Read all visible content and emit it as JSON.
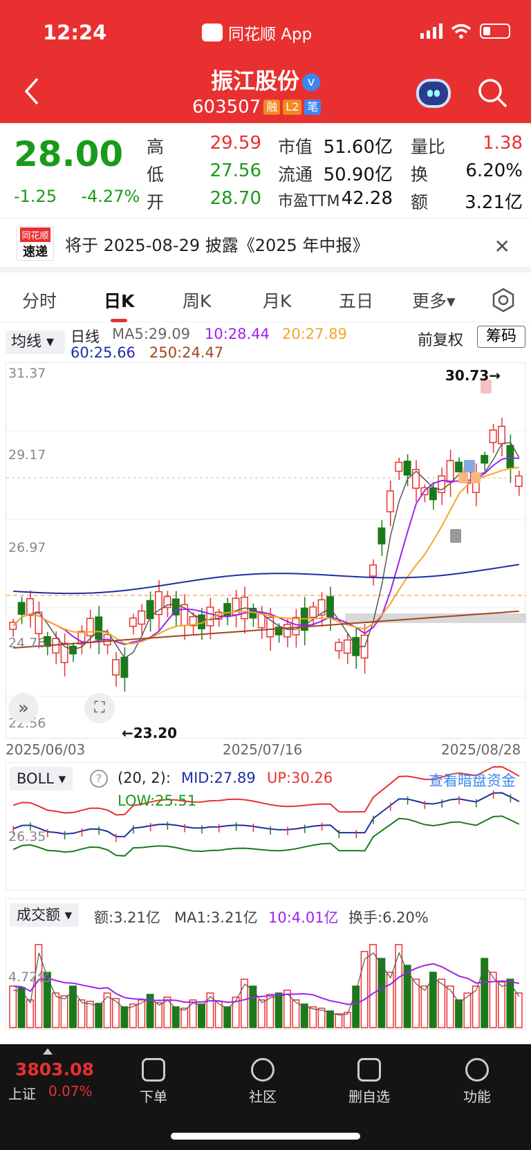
{
  "status_bar": {
    "time": "12:24",
    "app_name": "同花顺 App"
  },
  "header": {
    "stock_name": "振江股份",
    "verified": "v",
    "stock_code": "603507",
    "tags": [
      {
        "text": "融",
        "color": "#f08a24"
      },
      {
        "text": "L2",
        "color": "#f08a24"
      },
      {
        "text": "笔",
        "color": "#3d86f0"
      }
    ]
  },
  "quote": {
    "price": "28.00",
    "change": "-1.25",
    "change_pct": "-4.27%",
    "fields": [
      {
        "label": "高",
        "value": "29.59",
        "color": "#e93030"
      },
      {
        "label": "低",
        "value": "27.56",
        "color": "#1a9a1a"
      },
      {
        "label": "开",
        "value": "28.70",
        "color": "#1a9a1a"
      },
      {
        "label": "市值",
        "value": "51.60亿",
        "color": "#111"
      },
      {
        "label": "流通",
        "value": "50.90亿",
        "color": "#111"
      },
      {
        "label": "市盈TTM",
        "value": "42.28",
        "color": "#111"
      },
      {
        "label": "量比",
        "value": "1.38",
        "color": "#e93030"
      },
      {
        "label": "换",
        "value": "6.20%",
        "color": "#111"
      },
      {
        "label": "额",
        "value": "3.21亿",
        "color": "#111"
      }
    ]
  },
  "news": {
    "logo_top": "同花顺",
    "logo_bottom": "速递",
    "text": "将于 2025-08-29 披露《2025 年中报》"
  },
  "tabs": [
    "分时",
    "日K",
    "周K",
    "月K",
    "五日",
    "更多▾"
  ],
  "active_tab": "日K",
  "kline": {
    "ma_button": "均线 ▾",
    "period_label": "日线",
    "ma": [
      {
        "text": "MA5:29.09",
        "color": "#666666"
      },
      {
        "text": "10:28.44",
        "color": "#a020f0"
      },
      {
        "text": "20:27.89",
        "color": "#f5a623"
      },
      {
        "text": "60:25.66",
        "color": "#1f2ea0"
      },
      {
        "text": "250:24.47",
        "color": "#a0461e"
      }
    ],
    "adjust_label": "前复权",
    "chip_button": "筹码",
    "y_ticks": [
      "31.37",
      "29.17",
      "26.97",
      "24.76",
      "22.56"
    ],
    "max_label": "30.73→",
    "min_label": "←23.20",
    "dates": [
      "2025/06/03",
      "2025/07/16",
      "2025/08/28"
    ],
    "markers": [
      "B",
      "B",
      "S",
      "T",
      "T"
    ]
  },
  "boll": {
    "button": "BOLL ▾",
    "help": "?",
    "params": "(20, 2):",
    "mid": "MID:27.89",
    "up": "UP:30.26",
    "low": "LOW:25.51",
    "link": "查看暗盘资金",
    "y_tick": "26.35"
  },
  "volume": {
    "button": "成交额 ▾",
    "amt": "额:3.21亿",
    "ma1": "MA1:3.21亿",
    "ma10": "10:4.01亿",
    "turnover": "换手:6.20%",
    "y_tick": "4.72亿"
  },
  "bottom_bar": {
    "index_value": "3803.08",
    "index_name": "上证",
    "index_pct": "0.07%",
    "items": [
      {
        "label": "下单"
      },
      {
        "label": "社区"
      },
      {
        "label": "删自选"
      },
      {
        "label": "功能"
      }
    ]
  }
}
